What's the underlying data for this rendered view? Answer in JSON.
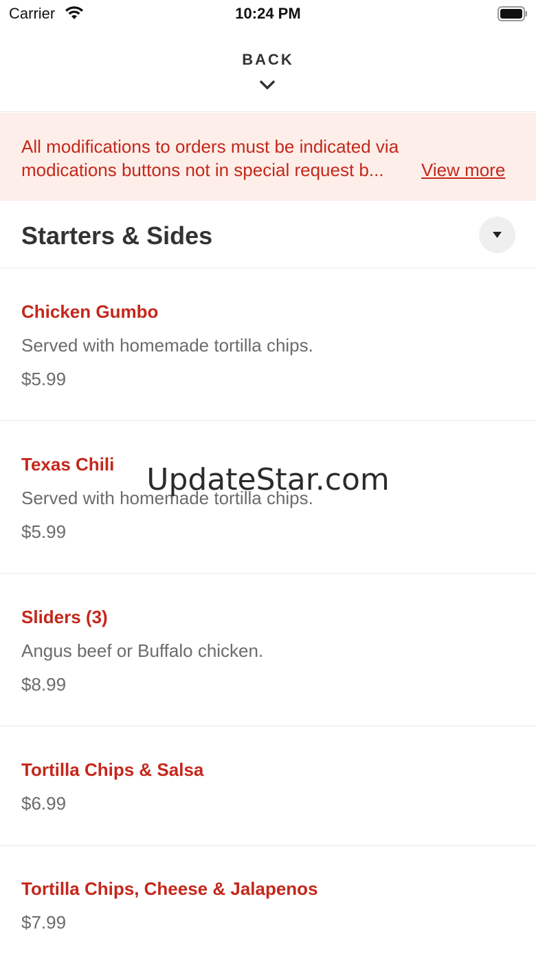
{
  "status_bar": {
    "carrier": "Carrier",
    "time": "10:24 PM",
    "wifi_icon": "wifi-icon",
    "battery_icon": "battery-icon"
  },
  "header": {
    "back_label": "BACK",
    "chevron_icon": "chevron-down-icon"
  },
  "notice": {
    "line1": "All modifications to orders must be indicated via",
    "line2": "modications buttons not in special request b...",
    "view_more": "View more",
    "background_color": "#fdeee9",
    "text_color": "#c4271b"
  },
  "section": {
    "title": "Starters & Sides",
    "toggle_icon": "caret-down-icon"
  },
  "items": [
    {
      "name": "Chicken Gumbo",
      "description": "Served with homemade tortilla chips.",
      "price": "$5.99"
    },
    {
      "name": "Texas Chili",
      "description": "Served with homemade tortilla chips.",
      "price": "$5.99"
    },
    {
      "name": "Sliders (3)",
      "description": "Angus beef or Buffalo chicken.",
      "price": "$8.99"
    },
    {
      "name": "Tortilla Chips & Salsa",
      "price": "$6.99"
    },
    {
      "name": "Tortilla Chips, Cheese & Jalapenos",
      "price": "$7.99"
    }
  ],
  "watermark": "UpdateStar.com",
  "colors": {
    "accent": "#c4271b",
    "muted_text": "#6b6b6b",
    "divider": "#e8e8e8"
  }
}
